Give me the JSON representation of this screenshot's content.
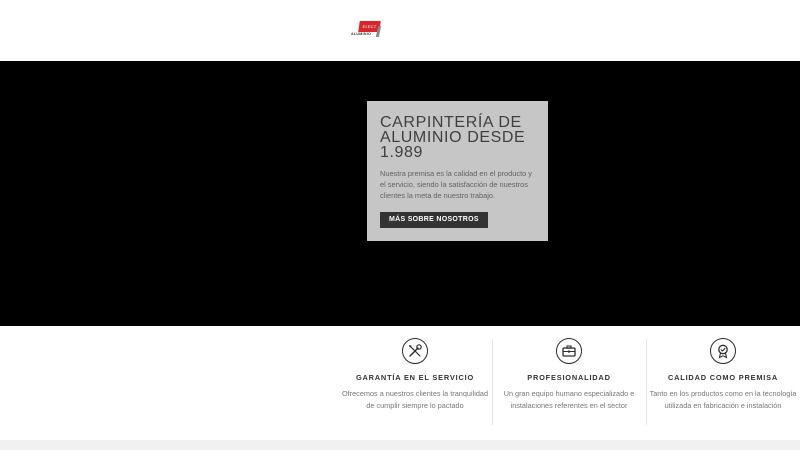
{
  "header": {
    "logo": {
      "badge_text": "ELECT",
      "word": "ALUMINIO"
    }
  },
  "hero": {
    "title": "CARPINTERÍA DE ALUMINIO DESDE 1.989",
    "description": "Nuestra premisa es la calidad en el producto y el servicio, siendo la satisfacción de nuestros clientes la meta de nuestro trabajo.",
    "button_label": "MÁS SOBRE NOSOTROS",
    "colors": {
      "background": "#000000",
      "box": "#c6c6c6",
      "button": "#333333"
    }
  },
  "features": [
    {
      "icon": "tools-icon",
      "title": "GARANTÍA EN EL SERVICIO",
      "text": "Ofrecemos a nuestros clientes la tranquilidad de cumplir siempre lo pactado"
    },
    {
      "icon": "briefcase-icon",
      "title": "PROFESIONALIDAD",
      "text": "Un gran equipo humano especializado e instalaciones referentes en el sector"
    },
    {
      "icon": "award-icon",
      "title": "CALIDAD COMO PREMISA",
      "text": "Tanto en los productos como en la tecnología utilizada en fabricación e instalación"
    }
  ]
}
